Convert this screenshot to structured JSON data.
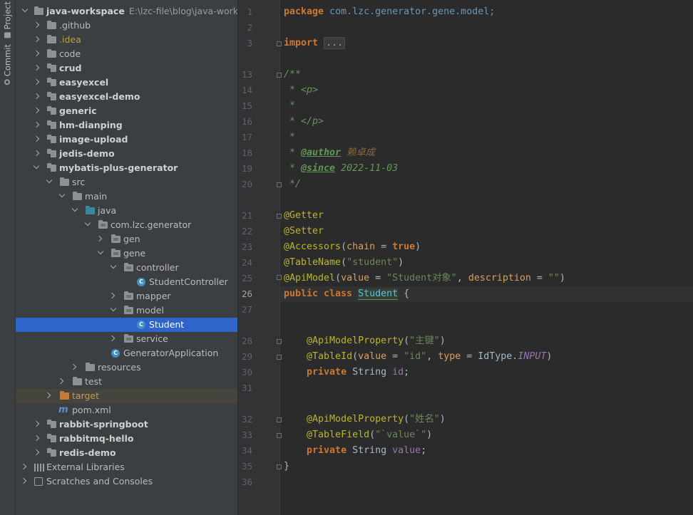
{
  "side_tabs": {
    "project": "Project",
    "commit": "Commit"
  },
  "tree": {
    "root_name": "java-workspace",
    "root_path": "E:\\lzc-file\\blog\\java-workspace",
    "items": [
      {
        "label": "java-workspace"
      },
      {
        "label": ".github"
      },
      {
        "label": ".idea"
      },
      {
        "label": "code"
      },
      {
        "label": "crud"
      },
      {
        "label": "easyexcel"
      },
      {
        "label": "easyexcel-demo"
      },
      {
        "label": "generic"
      },
      {
        "label": "hm-dianping"
      },
      {
        "label": "image-upload"
      },
      {
        "label": "jedis-demo"
      },
      {
        "label": "mybatis-plus-generator"
      },
      {
        "label": "src"
      },
      {
        "label": "main"
      },
      {
        "label": "java"
      },
      {
        "label": "com.lzc.generator"
      },
      {
        "label": "gen"
      },
      {
        "label": "gene"
      },
      {
        "label": "controller"
      },
      {
        "label": "StudentController"
      },
      {
        "label": "mapper"
      },
      {
        "label": "model"
      },
      {
        "label": "Student"
      },
      {
        "label": "service"
      },
      {
        "label": "GeneratorApplication"
      },
      {
        "label": "resources"
      },
      {
        "label": "test"
      },
      {
        "label": "target"
      },
      {
        "label": "pom.xml"
      },
      {
        "label": "rabbit-springboot"
      },
      {
        "label": "rabbitmq-hello"
      },
      {
        "label": "redis-demo"
      },
      {
        "label": "External Libraries"
      },
      {
        "label": "Scratches and Consoles"
      }
    ]
  },
  "editor": {
    "current_line": "26",
    "line_numbers": [
      "1",
      "2",
      "3",
      "13",
      "14",
      "15",
      "16",
      "17",
      "18",
      "19",
      "20",
      "21",
      "22",
      "23",
      "24",
      "25",
      "26",
      "27",
      "28",
      "29",
      "30",
      "31",
      "32",
      "33",
      "34",
      "35",
      "36"
    ],
    "code": {
      "package_kw": "package",
      "package_name": "com.lzc.generator.gene.model;",
      "import_kw": "import",
      "import_fold": "...",
      "doc_open": "/**",
      "doc_p": " * <p>",
      "doc_star": " *",
      "doc_p_close": " * </p>",
      "doc_star2": " *",
      "author_tag": "@author",
      "author_val": "赖卓成",
      "since_tag": "@since",
      "since_val": "2022-11-03",
      "doc_close": " */",
      "getter": "@Getter",
      "setter": "@Setter",
      "accessors": "@Accessors",
      "accessors_param": "chain",
      "true_kw": "true",
      "tablename": "@TableName",
      "tablename_val": "\"student\"",
      "apimodel": "@ApiModel",
      "value_param": "value",
      "apimodel_val": "\"Student对象\"",
      "description_param": "description",
      "empty_str": "\"\"",
      "public_class": "public class",
      "class_name": "Student",
      "brace_open": "{",
      "amp1": "@ApiModelProperty",
      "amp1_val": "\"主键\"",
      "tableid": "@TableId",
      "tableid_val": "\"id\"",
      "type_param": "type",
      "idtype": "IdType.",
      "input_enum": "INPUT",
      "private_kw": "private",
      "string_type": "String",
      "id_field": "id",
      "amp2_val": "\"姓名\"",
      "tablefield": "@TableField",
      "tablefield_val": "\"`value`\"",
      "value_field": "value",
      "brace_close": "}"
    }
  }
}
